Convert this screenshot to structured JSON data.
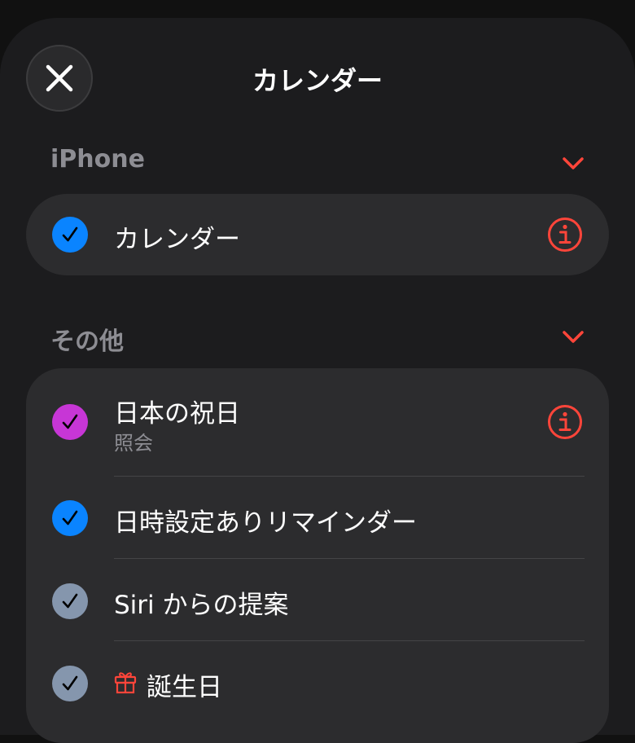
{
  "header": {
    "title": "カレンダー"
  },
  "sections": [
    {
      "title": "iPhone",
      "items": [
        {
          "label": "カレンダー",
          "checked": true,
          "color": "#0a84ff",
          "has_info": true
        }
      ]
    },
    {
      "title": "その他",
      "items": [
        {
          "label": "日本の祝日",
          "sublabel": "照会",
          "checked": true,
          "color": "#c736d6",
          "has_info": true
        },
        {
          "label": "日時設定ありリマインダー",
          "checked": true,
          "color": "#0a84ff",
          "has_info": false
        },
        {
          "label": "Siri からの提案",
          "checked": true,
          "color": "#8596ad",
          "has_info": false
        },
        {
          "label": "誕生日",
          "checked": true,
          "color": "#8596ad",
          "has_info": false,
          "icon": "gift-icon"
        }
      ]
    }
  ],
  "colors": {
    "accent": "#ff453a",
    "background": "#1c1c1e",
    "card": "#2c2c2e",
    "secondary_text": "#8d8d93"
  }
}
